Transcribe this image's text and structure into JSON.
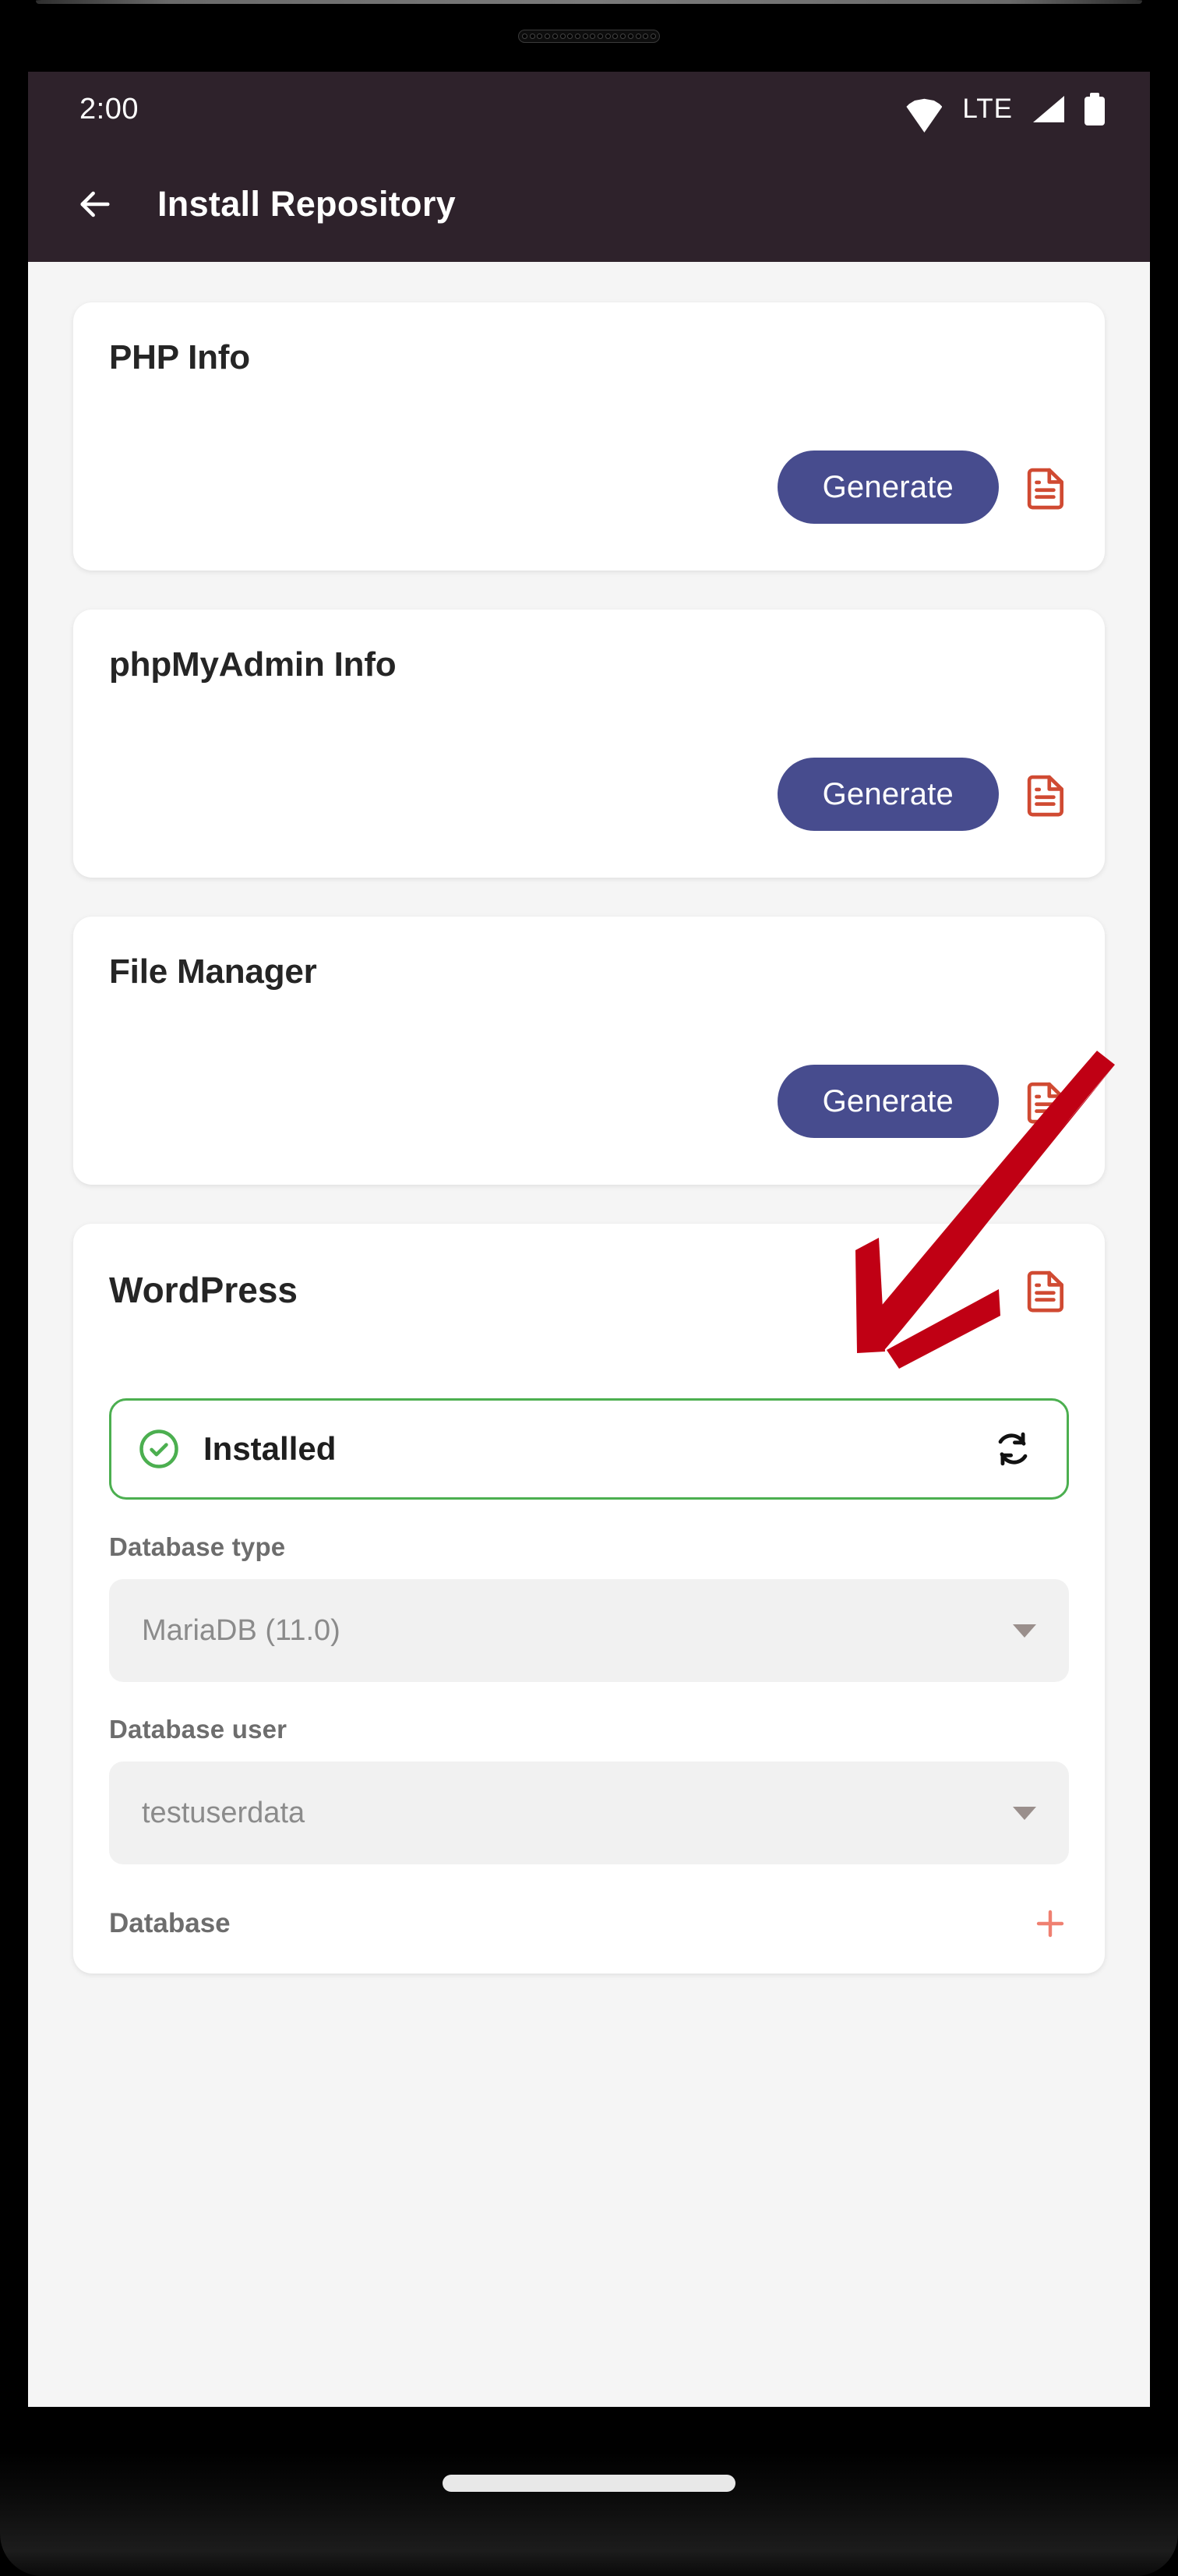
{
  "status_bar": {
    "time": "2:00",
    "network_label": "LTE",
    "icons": [
      "wifi-icon",
      "signal-icon",
      "battery-icon"
    ]
  },
  "app_bar": {
    "back_icon": "back-arrow-icon",
    "title": "Install Repository"
  },
  "theme": {
    "app_bar_bg": "#2e222b",
    "page_bg": "#f5f5f5",
    "card_bg": "#ffffff",
    "primary_button": "#474c8e",
    "doc_icon": "#d04a32",
    "success_green": "#4caf50",
    "add_icon": "#ef8071",
    "annotation_red": "#c00014"
  },
  "tools": [
    {
      "title": "PHP Info",
      "button_label": "Generate",
      "doc_icon": "document-icon"
    },
    {
      "title": "phpMyAdmin Info",
      "button_label": "Generate",
      "doc_icon": "document-icon"
    },
    {
      "title": "File Manager",
      "button_label": "Generate",
      "doc_icon": "document-icon"
    }
  ],
  "wordpress": {
    "title": "WordPress",
    "doc_icon": "document-icon",
    "status": {
      "label": "Installed",
      "check_icon": "check-circle-icon",
      "refresh_icon": "sync-icon"
    },
    "fields": [
      {
        "label": "Database type",
        "value": "MariaDB (11.0)",
        "control": "dropdown"
      },
      {
        "label": "Database user",
        "value": "testuserdata",
        "control": "dropdown"
      }
    ],
    "database_row": {
      "label": "Database",
      "add_icon": "plus-icon"
    }
  },
  "annotation": {
    "type": "arrow",
    "points_to": "File Manager Generate button"
  }
}
